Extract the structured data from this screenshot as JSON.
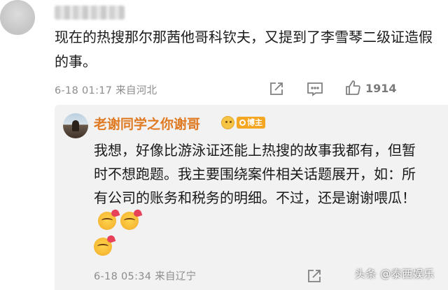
{
  "main_comment": {
    "text": "现在的热搜那尔那茜他哥科钦夫，又提到了李雪琴二级证造假的事。",
    "timestamp": "6-18 01:17",
    "location": "来自河北",
    "like_count": "1914"
  },
  "reply": {
    "username": "老谢同学之你谢哥",
    "badge_label": "博主",
    "text": "我想，好像比游泳证还能上热搜的故事我都有，但暂时不想跑题。我主要围绕案件相关话题展开，如：所有公司的账务和税务的明细。不过，还是谢谢喂瓜！",
    "timestamp": "6-18 05:34",
    "location": "来自辽宁"
  },
  "watermark": {
    "text": "头条 @泰西娱乐"
  },
  "icons": [
    "share-icon",
    "comment-icon",
    "thumbs-up-icon",
    "emoji-icon",
    "blogger-badge-icon"
  ],
  "colors": {
    "username": "#e07a22",
    "badge": "#f5a623",
    "meta_text": "#8c8c8c",
    "reply_bg": "#f2f2f2"
  }
}
